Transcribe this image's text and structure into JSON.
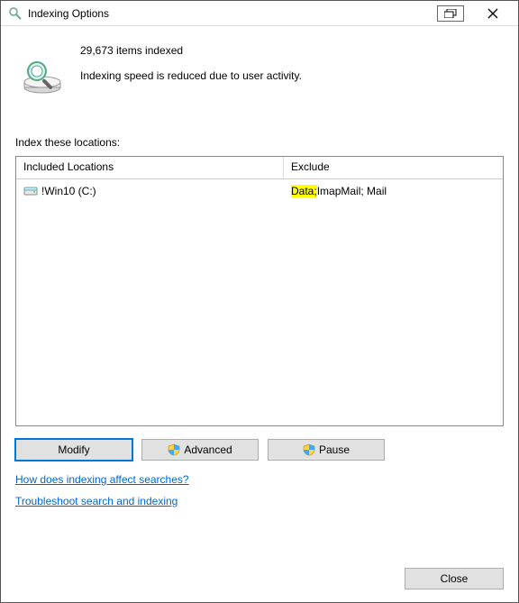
{
  "window": {
    "title": "Indexing Options"
  },
  "status": {
    "count_line": "29,673 items indexed",
    "speed_line": "Indexing speed is reduced due to user activity."
  },
  "section_label": "Index these locations:",
  "columns": {
    "included": "Included Locations",
    "exclude": "Exclude"
  },
  "rows": [
    {
      "location": "!Win10 (C:)",
      "exclude_highlight": "Data;",
      "exclude_rest": " ImapMail; Mail"
    }
  ],
  "buttons": {
    "modify": "Modify",
    "advanced": "Advanced",
    "pause": "Pause",
    "close": "Close"
  },
  "links": {
    "affect": "How does indexing affect searches?",
    "troubleshoot": "Troubleshoot search and indexing"
  }
}
